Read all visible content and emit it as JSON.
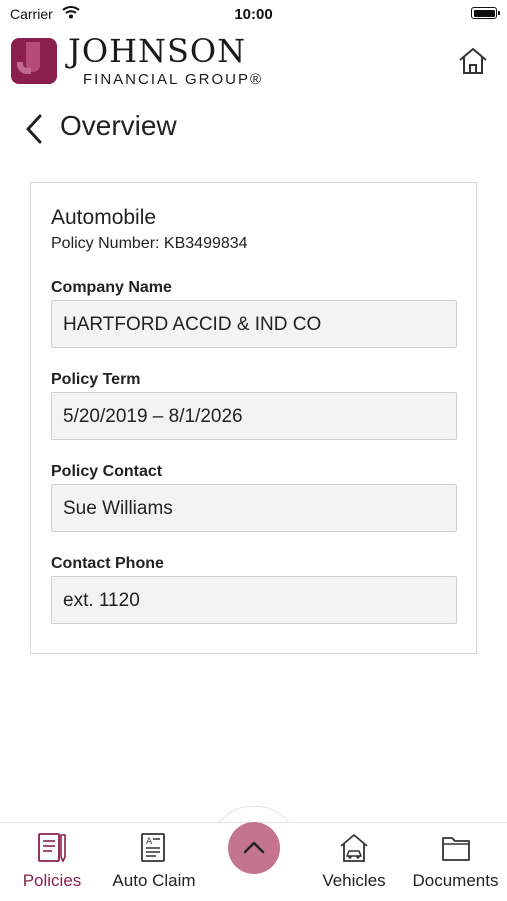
{
  "status_bar": {
    "carrier": "Carrier",
    "time": "10:00"
  },
  "header": {
    "logo_word": "JOHNSON",
    "logo_sub": "FINANCIAL GROUP®",
    "brand_color": "#8a1f4d",
    "home_icon": "home-icon"
  },
  "page": {
    "title": "Overview",
    "back_icon": "chevron-left-icon"
  },
  "policy": {
    "type": "Automobile",
    "number_text": "Policy Number: KB3499834",
    "fields": [
      {
        "label": "Company Name",
        "value": "HARTFORD ACCID & IND CO"
      },
      {
        "label": "Policy Term",
        "value": "5/20/2019 – 8/1/2026"
      },
      {
        "label": "Policy Contact",
        "value": "Sue Williams"
      },
      {
        "label": "Contact Phone",
        "value": "ext. 1120"
      }
    ]
  },
  "bottom_nav": {
    "items": [
      {
        "label": "Policies",
        "icon": "policies-icon",
        "active": true
      },
      {
        "label": "Auto Claim",
        "icon": "auto-claim-icon",
        "active": false
      },
      {
        "label": "Vehicles",
        "icon": "vehicles-icon",
        "active": false
      },
      {
        "label": "Documents",
        "icon": "documents-icon",
        "active": false
      }
    ],
    "fab_icon": "chevron-up-icon",
    "active_color": "#8a1f4d",
    "fab_color": "#c4748f"
  }
}
